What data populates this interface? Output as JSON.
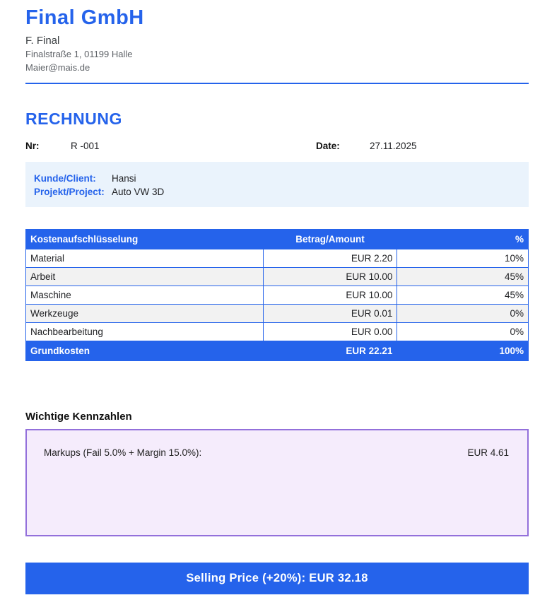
{
  "company": {
    "name": "Final GmbH",
    "contact_name": "F. Final",
    "address": "Finalstraße 1, 01199 Halle",
    "email": "Maier@mais.de"
  },
  "invoice": {
    "title": "RECHNUNG",
    "number_label": "Nr:",
    "number": "R -001",
    "date_label": "Date:",
    "date": "27.11.2025"
  },
  "client": {
    "client_label": "Kunde/Client:",
    "client_value": "Hansi",
    "project_label": "Projekt/Project:",
    "project_value": "Auto VW 3D"
  },
  "cost_table": {
    "headers": [
      "Kostenaufschlüsselung",
      "Betrag/Amount",
      "%"
    ],
    "rows": [
      {
        "label": "Material",
        "amount": "EUR 2.20",
        "percent": "10%"
      },
      {
        "label": "Arbeit",
        "amount": "EUR 10.00",
        "percent": "45%"
      },
      {
        "label": "Maschine",
        "amount": "EUR 10.00",
        "percent": "45%"
      },
      {
        "label": "Werkzeuge",
        "amount": "EUR 0.01",
        "percent": "0%"
      },
      {
        "label": "Nachbearbeitung",
        "amount": "EUR 0.00",
        "percent": "0%"
      }
    ],
    "total_row": {
      "label": "Grundkosten",
      "amount": "EUR 22.21",
      "percent": "100%"
    }
  },
  "kennzahlen": {
    "heading": "Wichtige Kennzahlen",
    "markup_label": "Markups (Fail 5.0% + Margin 15.0%):",
    "markup_value": "EUR 4.61"
  },
  "selling_price": {
    "banner": "Selling Price (+20%): EUR 32.18"
  },
  "colors": {
    "accent_blue": "#2563eb",
    "client_box_bg": "#eaf3fc",
    "kennzahlen_box_bg": "#f5ecfc",
    "kennzahlen_box_border": "#9370db",
    "table_alt_row_bg": "#f2f2f2",
    "muted_text": "#5f6368"
  }
}
